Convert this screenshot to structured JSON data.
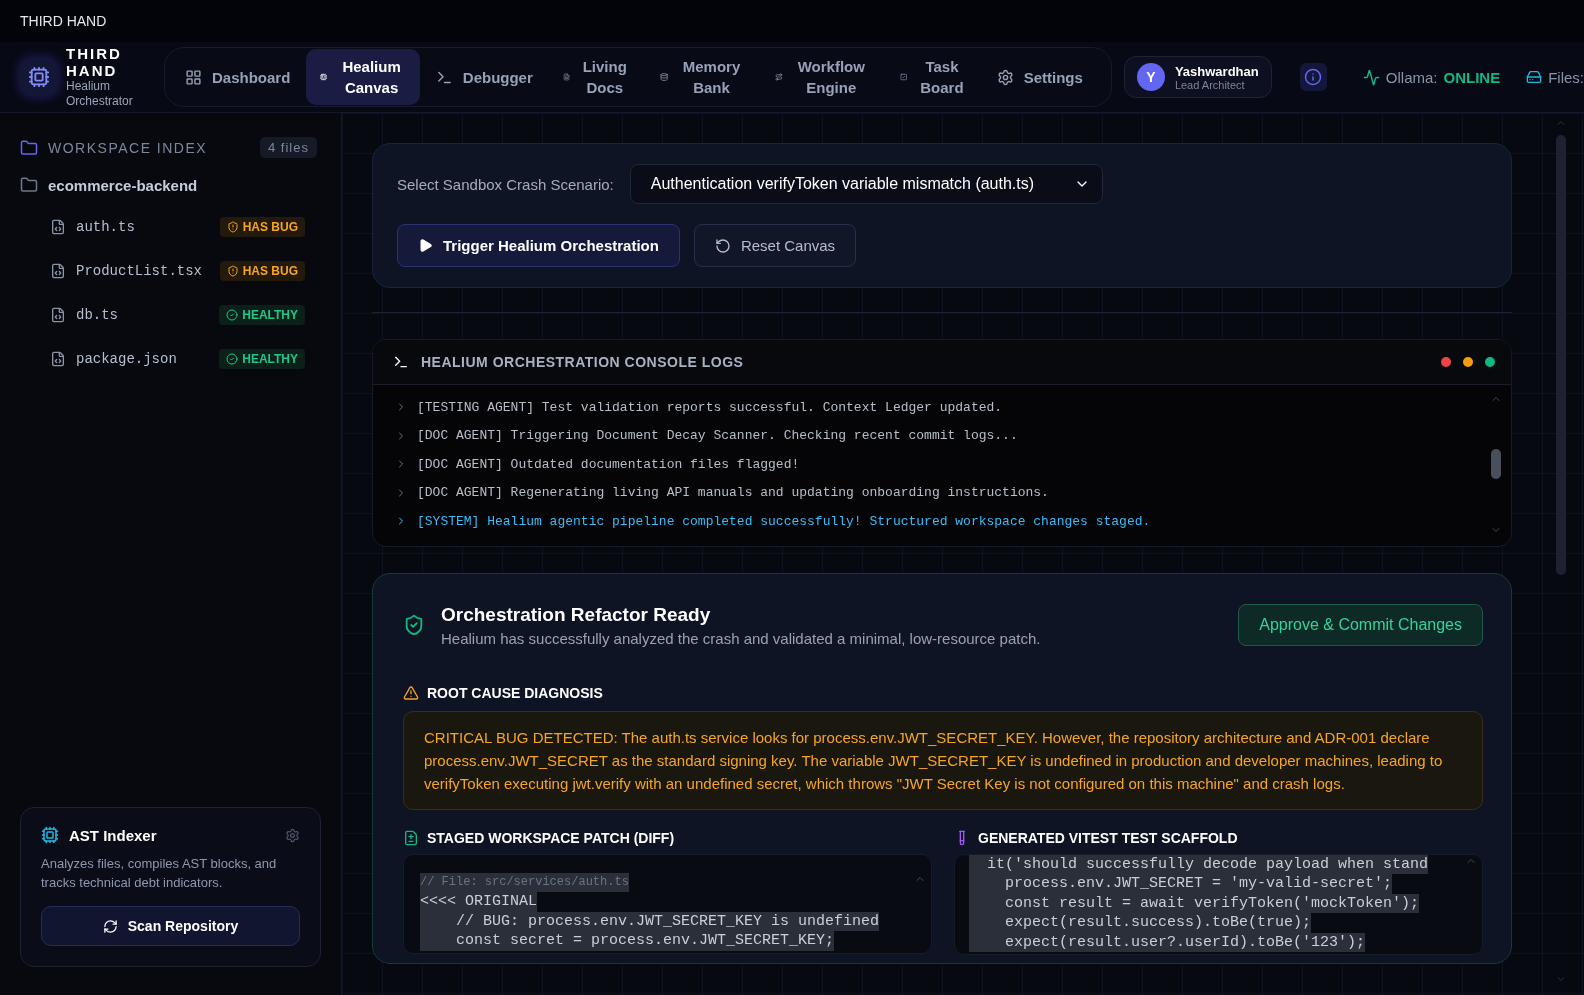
{
  "window": {
    "title": "THIRD HAND"
  },
  "brand": {
    "name": "THIRD HAND",
    "subtitle": "Healium Orchestrator"
  },
  "nav": [
    {
      "label": "Dashboard",
      "kind": "grid",
      "selected": false
    },
    {
      "label": "Healium Canvas",
      "kind": "chip",
      "selected": true
    },
    {
      "label": "Debugger",
      "kind": "terminal",
      "selected": false
    },
    {
      "label": "Living Docs",
      "kind": "doc",
      "selected": false
    },
    {
      "label": "Memory Bank",
      "kind": "database",
      "selected": false
    },
    {
      "label": "Workflow Engine",
      "kind": "route",
      "selected": false
    },
    {
      "label": "Task Board",
      "kind": "task",
      "selected": false
    },
    {
      "label": "Settings",
      "kind": "gear",
      "selected": false
    }
  ],
  "user": {
    "initial": "Y",
    "name": "Yashwardhan",
    "role": "Lead Architect"
  },
  "status": {
    "label": "Ollama:",
    "value": "ONLINE",
    "files_label": "Files:"
  },
  "sidebar": {
    "title": "WORKSPACE INDEX",
    "count": "4 files",
    "folder": "ecommerce-backend",
    "files": [
      {
        "name": "auth.ts",
        "status": "HAS BUG",
        "kind": "bug"
      },
      {
        "name": "ProductList.tsx",
        "status": "HAS BUG",
        "kind": "bug"
      },
      {
        "name": "db.ts",
        "status": "HEALTHY",
        "kind": "healthy"
      },
      {
        "name": "package.json",
        "status": "HEALTHY",
        "kind": "healthy"
      }
    ]
  },
  "indexer": {
    "title": "AST Indexer",
    "description": "Analyzes files, compiles AST blocks, and tracks technical debt indicators.",
    "button": "Scan Repository"
  },
  "scenario": {
    "label": "Select Sandbox Crash Scenario:",
    "value": "Authentication verifyToken variable mismatch (auth.ts)",
    "buttons": [
      {
        "label": "Trigger Healium Orchestration",
        "kind": "primary"
      },
      {
        "label": "Reset Canvas",
        "kind": "secondary"
      }
    ]
  },
  "console": {
    "title": "HEALIUM ORCHESTRATION CONSOLE LOGS",
    "lines": [
      {
        "text": "[TESTING AGENT] Test validation reports successful. Context Ledger updated.",
        "kind": "info"
      },
      {
        "text": "[DOC AGENT] Triggering Document Decay Scanner. Checking recent commit logs...",
        "kind": "info"
      },
      {
        "text": "[DOC AGENT] Outdated documentation files flagged!",
        "kind": "info"
      },
      {
        "text": "[DOC AGENT] Regenerating living API manuals and updating onboarding instructions.",
        "kind": "info"
      },
      {
        "text": "[SYSTEM] Healium agentic pipeline completed successfully! Structured workspace changes staged.",
        "kind": "system"
      }
    ]
  },
  "result": {
    "title": "Orchestration Refactor Ready",
    "subtitle": "Healium has successfully analyzed the crash and validated a minimal, low-resource patch.",
    "approve": "Approve & Commit Changes",
    "diagnosis_title": "ROOT CAUSE DIAGNOSIS",
    "diagnosis": "CRITICAL BUG DETECTED: The auth.ts service looks for process.env.JWT_SECRET_KEY. However, the repository architecture and ADR-001 declare process.env.JWT_SECRET as the standard signing key. The variable JWT_SECRET_KEY is undefined in production and developer machines, leading to verifyToken executing jwt.verify with an undefined secret, which throws \"JWT Secret Key is not configured on this machine\" and crash logs.",
    "patch_title": "STAGED WORKSPACE PATCH (DIFF)",
    "patch_lines": [
      {
        "text": "// File: src/services/auth.ts",
        "kind": "comment"
      },
      {
        "text": "<<<< ORIGINAL",
        "kind": "code"
      },
      {
        "text": "    // BUG: process.env.JWT_SECRET_KEY is undefined",
        "kind": "code"
      },
      {
        "text": "    const secret = process.env.JWT_SECRET_KEY;",
        "kind": "code"
      }
    ],
    "test_title": "GENERATED VITEST TEST SCAFFOLD",
    "test_lines": [
      "  it('should successfully decode payload when stand",
      "    process.env.JWT_SECRET = 'my-valid-secret';",
      "    const result = await verifyToken('mockToken');",
      "    expect(result.success).toBe(true);",
      "    expect(result.user?.userId).toBe('123');"
    ]
  }
}
